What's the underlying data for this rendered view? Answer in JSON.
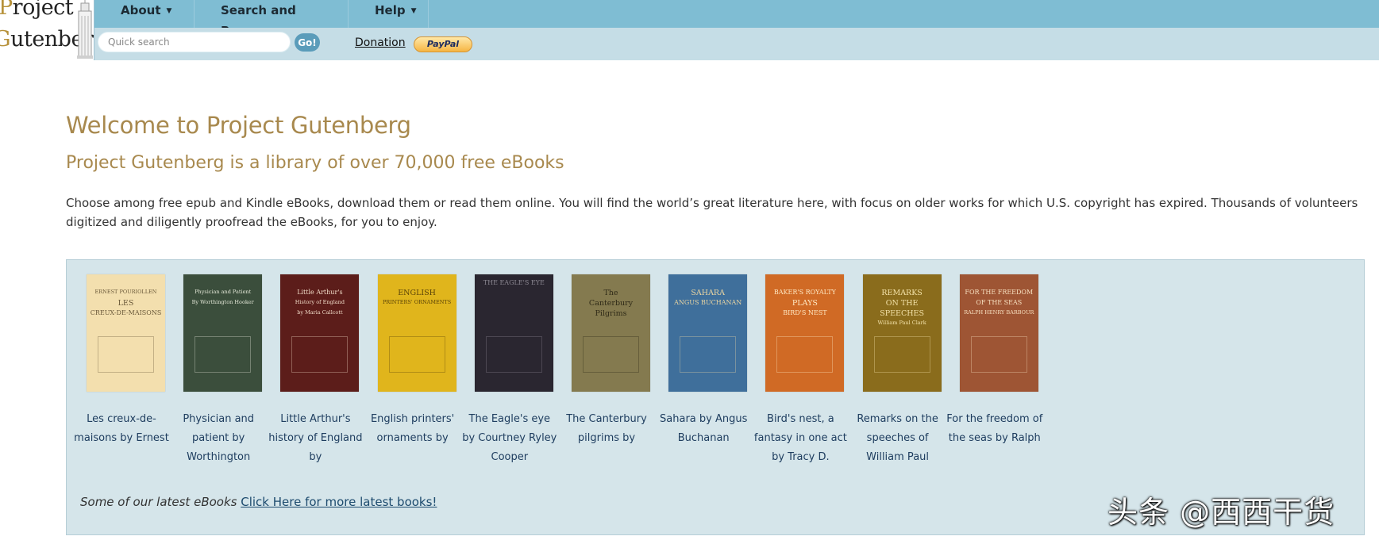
{
  "logo": {
    "line1_first": "P",
    "line1_rest": "roject",
    "line2_first": "G",
    "line2_rest": "utenberg"
  },
  "nav": {
    "items": [
      {
        "label": "About"
      },
      {
        "label": "Search and Browse"
      },
      {
        "label": "Help"
      }
    ],
    "caret": "▼"
  },
  "search": {
    "placeholder": "Quick search",
    "value": "",
    "go_label": "Go!"
  },
  "donation": {
    "label": "Donation",
    "paypal_label": "PayPal"
  },
  "main": {
    "title": "Welcome to Project Gutenberg",
    "subtitle": "Project Gutenberg is a library of over 70,000 free eBooks",
    "intro": "Choose among free epub and Kindle eBooks, download them or read them online. You will find the world’s great literature here, with focus on older works for which U.S. copyright has expired. Thousands of volunteers digitized and diligently proofread the eBooks, for you to enjoy."
  },
  "books": [
    {
      "title": "Les creux-de-maisons by Ernest",
      "cover_lines": [
        "ERNEST POURIOLLEN",
        "LES",
        "CREUX-DE-MAISONS"
      ],
      "cover_bg": "#f3dfae",
      "cover_fg": "#6b5a3a"
    },
    {
      "title": "Physician and patient by Worthington",
      "cover_lines": [
        "Physician and Patient",
        "By Worthington Hooker"
      ],
      "cover_bg": "#3b4e3c",
      "cover_fg": "#e2e6d6"
    },
    {
      "title": "Little Arthur's history of England by",
      "cover_lines": [
        "Little Arthur's",
        "History of England",
        "by Maria Callcott"
      ],
      "cover_bg": "#5c1d1a",
      "cover_fg": "#f1dcc8"
    },
    {
      "title": "English printers' ornaments by",
      "cover_lines": [
        "ENGLISH",
        "PRINTERS' ORNAMENTS"
      ],
      "cover_bg": "#e0b51c",
      "cover_fg": "#5a4308"
    },
    {
      "title": "The Eagle's eye by Courtney Ryley Cooper",
      "cover_lines": [
        "THE EAGLE'S EYE"
      ],
      "cover_bg": "#2a2630",
      "cover_fg": "#8b8791"
    },
    {
      "title": "The Canterbury pilgrims by",
      "cover_lines": [
        "The",
        "Canterbury",
        "Pilgrims"
      ],
      "cover_bg": "#847a4f",
      "cover_fg": "#2f2a17"
    },
    {
      "title": "Sahara by Angus Buchanan",
      "cover_lines": [
        "SAHARA",
        "ANGUS BUCHANAN"
      ],
      "cover_bg": "#3f6f9b",
      "cover_fg": "#e8d4a2"
    },
    {
      "title": "Bird's nest, a fantasy in one act by Tracy D.",
      "cover_lines": [
        "BAKER'S ROYALTY",
        "PLAYS",
        "BIRD'S NEST"
      ],
      "cover_bg": "#d06a25",
      "cover_fg": "#ffe9c4"
    },
    {
      "title": "Remarks on the speeches of William Paul",
      "cover_lines": [
        "REMARKS",
        "ON THE",
        "SPEECHES",
        "William Paul Clark"
      ],
      "cover_bg": "#8a6c1c",
      "cover_fg": "#f3e2a9"
    },
    {
      "title": "For the freedom of the seas by Ralph",
      "cover_lines": [
        "FOR THE FREEDOM",
        "OF THE SEAS",
        "RALPH HENRY BARBOUR"
      ],
      "cover_bg": "#9e5534",
      "cover_fg": "#f7e0c0"
    }
  ],
  "latest": {
    "lead": "Some of our latest eBooks",
    "link": "Click Here for more latest books!"
  },
  "watermark": "头条 @西西干货"
}
